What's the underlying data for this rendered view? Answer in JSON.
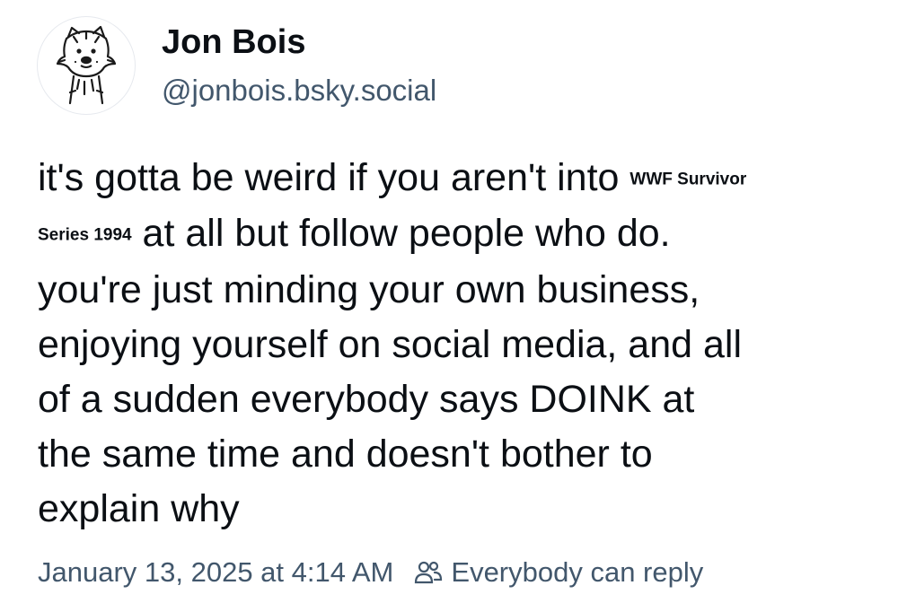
{
  "author": {
    "display_name": "Jon Bois",
    "handle": "@jonbois.bsky.social",
    "avatar_icon": "hobbes-tiger-avatar"
  },
  "post": {
    "segments": {
      "l1_text": "it's gotta be weird if you aren't into ",
      "l1_muted": "WWF Survivor",
      "l2_muted": "Series 1994",
      "l2_text": " at all but follow people who do.",
      "l3": "you're just minding your own business,",
      "l4": "enjoying yourself on social media, and all",
      "l5": "of a sudden everybody says DOINK at",
      "l6": "the same time and doesn't bother to",
      "l7": "explain why"
    }
  },
  "meta": {
    "timestamp": "January 13, 2025 at 4:14 AM",
    "reply_setting": "Everybody can reply",
    "reply_icon": "people-icon"
  },
  "colors": {
    "text": "#0b0f14",
    "muted": "#42576c",
    "background": "#ffffff"
  }
}
